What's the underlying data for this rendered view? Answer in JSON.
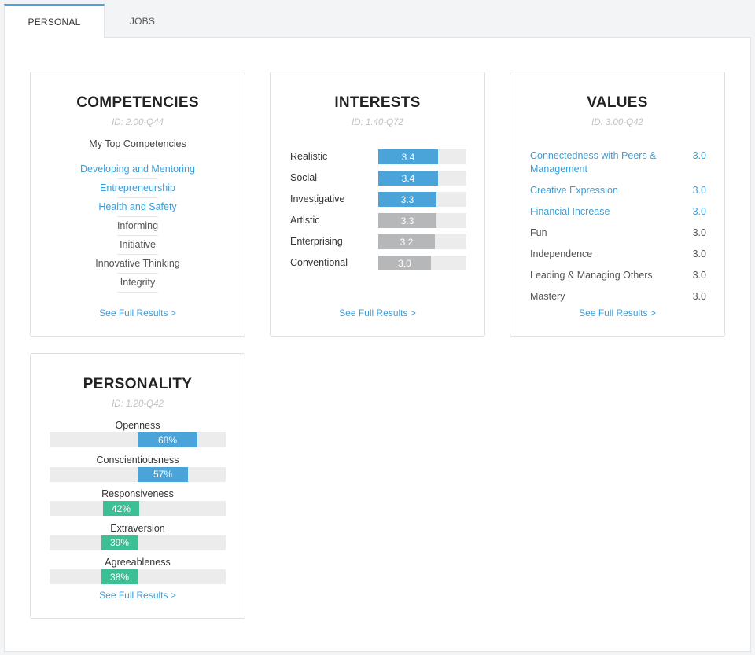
{
  "tabs": [
    {
      "label": "PERSONAL",
      "active": true
    },
    {
      "label": "JOBS",
      "active": false
    }
  ],
  "colors": {
    "accent": "#4aa3d9",
    "link": "#3c9dd6",
    "green": "#3dbf96",
    "gray_bar": "#b5b7b9",
    "track": "#ececec"
  },
  "competencies": {
    "title": "COMPETENCIES",
    "id": "ID: 2.00-Q44",
    "subtitle": "My Top Competencies",
    "items": [
      {
        "label": "Developing and Mentoring",
        "linked": true
      },
      {
        "label": "Entrepreneurship",
        "linked": true
      },
      {
        "label": "Health and Safety",
        "linked": true
      },
      {
        "label": "Informing",
        "linked": false
      },
      {
        "label": "Initiative",
        "linked": false
      },
      {
        "label": "Innovative Thinking",
        "linked": false
      },
      {
        "label": "Integrity",
        "linked": false
      }
    ],
    "see_full": "See Full Results >"
  },
  "interests": {
    "title": "INTERESTS",
    "id": "ID: 1.40-Q72",
    "max": 5,
    "items": [
      {
        "label": "Realistic",
        "value": 3.4,
        "display": "3.4",
        "highlighted": true
      },
      {
        "label": "Social",
        "value": 3.4,
        "display": "3.4",
        "highlighted": true
      },
      {
        "label": "Investigative",
        "value": 3.3,
        "display": "3.3",
        "highlighted": true
      },
      {
        "label": "Artistic",
        "value": 3.3,
        "display": "3.3",
        "highlighted": false
      },
      {
        "label": "Enterprising",
        "value": 3.2,
        "display": "3.2",
        "highlighted": false
      },
      {
        "label": "Conventional",
        "value": 3.0,
        "display": "3.0",
        "highlighted": false
      }
    ],
    "see_full": "See Full Results >"
  },
  "values": {
    "title": "VALUES",
    "id": "ID: 3.00-Q42",
    "items": [
      {
        "label": "Connectedness with Peers & Management",
        "value": "3.0",
        "linked": true
      },
      {
        "label": "Creative Expression",
        "value": "3.0",
        "linked": true
      },
      {
        "label": "Financial Increase",
        "value": "3.0",
        "linked": true
      },
      {
        "label": "Fun",
        "value": "3.0",
        "linked": false
      },
      {
        "label": "Independence",
        "value": "3.0",
        "linked": false
      },
      {
        "label": "Leading & Managing Others",
        "value": "3.0",
        "linked": false
      },
      {
        "label": "Mastery",
        "value": "3.0",
        "linked": false
      }
    ],
    "see_full": "See Full Results >"
  },
  "personality": {
    "title": "PERSONALITY",
    "id": "ID: 1.20-Q42",
    "items": [
      {
        "label": "Openness",
        "percent": 68,
        "display": "68%",
        "color": "blue"
      },
      {
        "label": "Conscientiousness",
        "percent": 57,
        "display": "57%",
        "color": "blue"
      },
      {
        "label": "Responsiveness",
        "percent": 42,
        "display": "42%",
        "color": "green"
      },
      {
        "label": "Extraversion",
        "percent": 39,
        "display": "39%",
        "color": "green"
      },
      {
        "label": "Agreeableness",
        "percent": 38,
        "display": "38%",
        "color": "green"
      }
    ],
    "see_full": "See Full Results >"
  }
}
